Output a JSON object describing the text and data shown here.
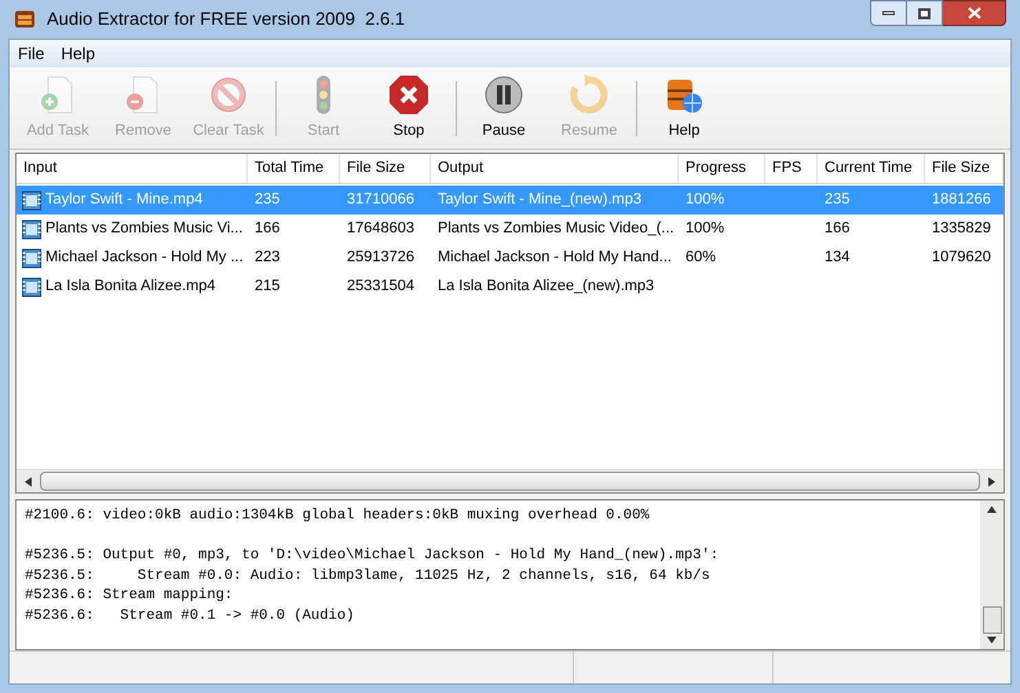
{
  "window": {
    "title": "Audio Extractor for FREE version 2009  2.6.1"
  },
  "menu": [
    "File",
    "Help"
  ],
  "toolbar": [
    {
      "label": "Add Task",
      "kind": "add",
      "disabled": true,
      "separator_after": false
    },
    {
      "label": "Remove",
      "kind": "remove",
      "disabled": true,
      "separator_after": false
    },
    {
      "label": "Clear Task",
      "kind": "clear",
      "disabled": true,
      "separator_after": true
    },
    {
      "label": "Start",
      "kind": "start",
      "disabled": true,
      "separator_after": false
    },
    {
      "label": "Stop",
      "kind": "stop",
      "disabled": false,
      "separator_after": true
    },
    {
      "label": "Pause",
      "kind": "pause",
      "disabled": false,
      "separator_after": false
    },
    {
      "label": "Resume",
      "kind": "resume",
      "disabled": true,
      "separator_after": true
    },
    {
      "label": "Help",
      "kind": "help",
      "disabled": false,
      "separator_after": false
    }
  ],
  "table": {
    "columns": [
      "Input",
      "Total Time",
      "File Size",
      "Output",
      "Progress",
      "FPS",
      "Current Time",
      "File Size"
    ],
    "rows": [
      {
        "selected": true,
        "cells": [
          "Taylor Swift - Mine.mp4",
          "235",
          "31710066",
          "Taylor Swift - Mine_(new).mp3",
          "100%",
          "",
          "235",
          "1881266"
        ]
      },
      {
        "selected": false,
        "cells": [
          "Plants vs Zombies Music Vi...",
          "166",
          "17648603",
          "Plants vs Zombies Music Video_(...",
          "100%",
          "",
          "166",
          "1335829"
        ]
      },
      {
        "selected": false,
        "cells": [
          "Michael Jackson - Hold My ...",
          "223",
          "25913726",
          "Michael Jackson - Hold My Hand...",
          "60%",
          "",
          "134",
          "1079620"
        ]
      },
      {
        "selected": false,
        "cells": [
          "La Isla Bonita Alizee.mp4",
          "215",
          "25331504",
          "La Isla Bonita Alizee_(new).mp3",
          "",
          "",
          "",
          ""
        ]
      }
    ]
  },
  "log": {
    "blocks": [
      [
        "#2100.6: video:0kB audio:1304kB global headers:0kB muxing overhead 0.00%"
      ],
      [
        "#5236.5: Output #0, mp3, to 'D:\\video\\Michael Jackson - Hold My Hand_(new).mp3':",
        "#5236.5:     Stream #0.0: Audio: libmp3lame, 11025 Hz, 2 channels, s16, 64 kb/s",
        "#5236.6: Stream mapping:",
        "#5236.6:   Stream #0.1 -> #0.0 (Audio)"
      ]
    ]
  }
}
